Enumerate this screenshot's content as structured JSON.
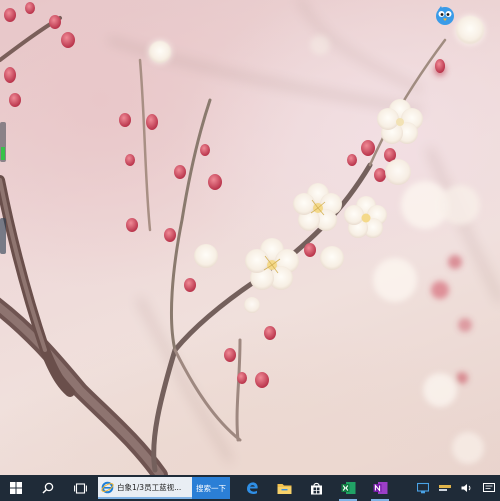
{
  "desktop": {
    "widgets": [
      {
        "name": "battery",
        "level": 0.35
      },
      {
        "name": "signal",
        "level": 0.3
      }
    ],
    "icons": [
      {
        "name": "bird-icon"
      }
    ]
  },
  "taskbar": {
    "start": {
      "icon": "windows-start-icon"
    },
    "search": {
      "icon": "search-icon"
    },
    "task_view": {
      "icon": "task-view-icon"
    },
    "ie_task": {
      "icon": "internet-explorer-icon",
      "label": "白象1/3员工蓝视..."
    },
    "search_button": {
      "label": "搜索一下"
    },
    "pinned": [
      {
        "name": "edge-icon"
      },
      {
        "name": "file-explorer-icon"
      },
      {
        "name": "store-icon"
      },
      {
        "name": "excel-icon"
      },
      {
        "name": "onenote-icon"
      }
    ],
    "tray": [
      {
        "name": "network-icon"
      },
      {
        "name": "app-indicator-icon"
      },
      {
        "name": "volume-icon"
      },
      {
        "name": "notification-icon"
      }
    ],
    "colors": {
      "background": "#1f2b38",
      "accent": "#2b7fd6"
    }
  }
}
